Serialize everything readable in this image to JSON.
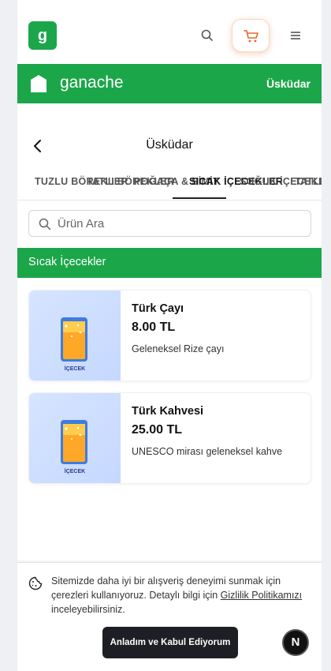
{
  "header": {
    "logo_letter": "g",
    "icons": [
      "search-icon",
      "cart-icon",
      "menu-icon"
    ],
    "accent_color": "#1ca64a"
  },
  "brand": {
    "name": "ganache",
    "location": "Üsküdar"
  },
  "page": {
    "title": "Üsküdar"
  },
  "tabs": [
    {
      "label": "TUZLU BÖREKLER",
      "active": false
    },
    {
      "label": "TATLI BÖREKLER",
      "active": false
    },
    {
      "label": "POĞAÇA & SİMİT",
      "active": false
    },
    {
      "label": "SICAK İÇECEKLER",
      "active": true
    },
    {
      "label": "SOĞUK İÇECEKLER",
      "active": false
    },
    {
      "label": "TATLILAR",
      "active": false
    }
  ],
  "search": {
    "placeholder": "Ürün Ara",
    "value": ""
  },
  "category": {
    "title": "Sıcak İçecekler"
  },
  "products": [
    {
      "name": "Türk Çayı",
      "price": "8.00 TL",
      "description": "Geleneksel Rize çayı",
      "image_label": "İÇECEK"
    },
    {
      "name": "Türk Kahvesi",
      "price": "25.00 TL",
      "description": "UNESCO mirası geleneksel kahve",
      "image_label": "İÇECEK"
    }
  ],
  "cookie": {
    "text_before": "Sitemizde daha iyi bir alışveriş deneyimi sunmak için çerezleri kullanıyoruz. Detaylı bilgi için ",
    "link": "Gizlilik Politikamızı",
    "text_after": " inceleyebilirsiniz.",
    "accept_label": "Anladım ve Kabul Ediyorum"
  },
  "dev_badge": "N"
}
